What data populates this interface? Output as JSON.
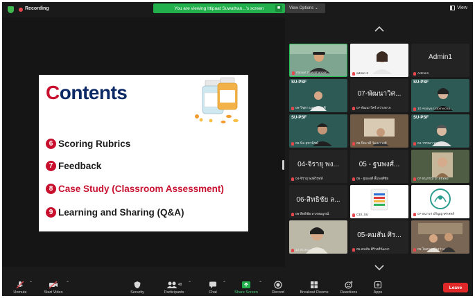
{
  "top_bar": {
    "recording_label": "Recording",
    "viewing_banner": "You are viewing Ittipaat Suwathan...'s screen",
    "view_options_label": "View Options ⌄",
    "view_label": "View"
  },
  "slide": {
    "title_first_letter": "C",
    "title_rest": "ontents",
    "items": [
      {
        "num": "6",
        "text": "Scoring Rubrics"
      },
      {
        "num": "7",
        "text": "Feedback"
      },
      {
        "num": "8",
        "text": "Case Study (Classroom Assessment)"
      },
      {
        "num": "9",
        "text": "Learning and Sharing (Q&A)"
      }
    ]
  },
  "gallery": {
    "tiles": [
      {
        "name": "Ittipaat Suwathanpor..."
      },
      {
        "name": "admin 2"
      },
      {
        "big": "Admin1",
        "name": "Admin1"
      },
      {
        "tag": "SU-PSF",
        "name": "09-วิชุดา แดงสามัคคี"
      },
      {
        "big": "07-พัฒนาวิศ...",
        "name": "07-พัฒนาวิศร์ สว่างลาภ"
      },
      {
        "tag": "SU-PSF",
        "name": "10 Aranya Udomvicha..."
      },
      {
        "tag": "SU-PSF",
        "name": "09-นิล สุขวนิชย์"
      },
      {
        "name": "06-ปิยะวดี วัฒนาวงศ์"
      },
      {
        "tag": "SU-PSF",
        "name": "04-วรรณา ทองสุข"
      },
      {
        "big": "04-จิรายุ พง...",
        "name": "04-จิรายุ พงษ์วิรุฬห์"
      },
      {
        "big": "05 - ฐนพงศ์...",
        "name": "05 - ฐนพงศ์ ลิ้มพงศ์ชัย"
      },
      {
        "name": "07-ธนภรณ์ มาลัยทอง"
      },
      {
        "big": "06-สิทธิชัย ล...",
        "name": "06-สิทธิชัย ลาภสมบูรณ์"
      },
      {
        "name": "CEI_SU"
      },
      {
        "name": "07-อนาวร ปรัญญาศาสตร์"
      },
      {
        "name": "12 RUKCHANOK R..."
      },
      {
        "big": "05-คมสัน ศิร...",
        "name": "05-คมสัน ศิริวงศ์วัฒนา"
      },
      {
        "name": "09-ไพศาล คำสว่าง"
      }
    ]
  },
  "toolbar": {
    "unmute": "Unmute",
    "start_video": "Start Video",
    "security": "Security",
    "participants": "Participants",
    "participants_count": "48",
    "chat": "Chat",
    "share_screen": "Share Screen",
    "record": "Record",
    "breakout_rooms": "Breakout Rooms",
    "reactions": "Reactions",
    "apps": "Apps",
    "leave": "Leave"
  },
  "colors": {
    "banner_green": "#21b04b",
    "leave_red": "#e02828",
    "slide_title_navy": "#0c2a66",
    "slide_accent_red": "#c8102e"
  }
}
